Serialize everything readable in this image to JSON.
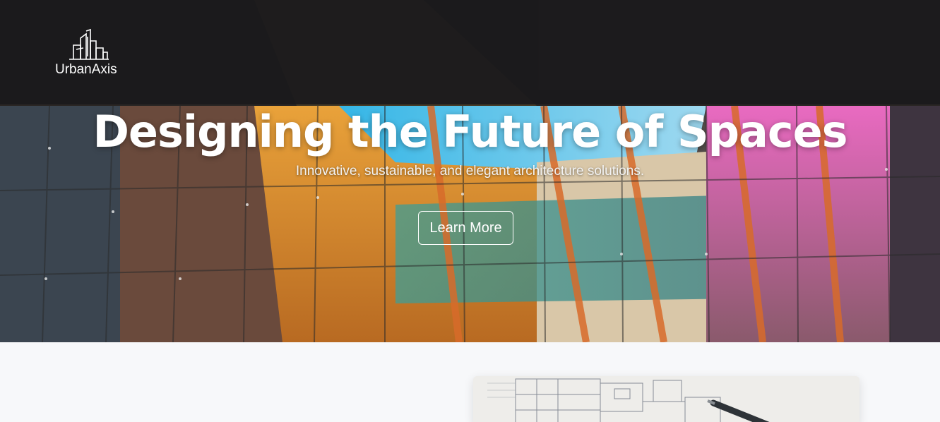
{
  "brand": {
    "name": "UrbanAxis",
    "logo_icon": "city-skyline-icon"
  },
  "hero": {
    "title": "Designing the Future of Spaces",
    "subtitle": "Innovative, sustainable, and elegant architecture solutions.",
    "cta_label": "Learn More",
    "background_image": "glass-facade-reflection-photo"
  },
  "content": {
    "image": "architectural-blueprint-photo"
  },
  "colors": {
    "header_overlay": "#1a1a1c",
    "text_light": "#ffffff",
    "page_background": "#f7f8fa"
  }
}
